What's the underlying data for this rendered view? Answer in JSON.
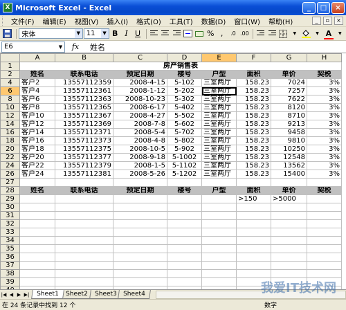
{
  "window": {
    "title": "Microsoft Excel - Excel",
    "app_icon": "excel-icon",
    "min": "_",
    "max": "□",
    "close": "×"
  },
  "menu": [
    "文件(F)",
    "编辑(E)",
    "视图(V)",
    "插入(I)",
    "格式(O)",
    "工具(T)",
    "数据(D)",
    "窗口(W)",
    "帮助(H)"
  ],
  "toolbar": {
    "font_name": "宋体",
    "font_size": "11",
    "bold": "B",
    "italic": "I",
    "underline": "U",
    "percent": "%",
    "comma": ","
  },
  "formula": {
    "cell_ref": "E6",
    "fx": "fx",
    "value": "姓名"
  },
  "columns": [
    "A",
    "B",
    "C",
    "D",
    "E",
    "F",
    "G",
    "H"
  ],
  "title_row": {
    "row": "1",
    "text": "房产销售表"
  },
  "header": [
    "姓名",
    "联系电话",
    "预定日期",
    "楼号",
    "户型",
    "面积",
    "单价",
    "契税"
  ],
  "header_rows": [
    "2",
    "28"
  ],
  "data_rows": [
    {
      "row": "4",
      "name": "客户2",
      "phone": "13557112359",
      "date": "2008-4-15",
      "bldg": "5-102",
      "type": "三室两厅",
      "area": "158.23",
      "price": "7024",
      "tax": "3%"
    },
    {
      "row": "6",
      "name": "客户4",
      "phone": "13557112361",
      "date": "2008-1-12",
      "bldg": "5-202",
      "type": "三室两厅",
      "area": "158.23",
      "price": "7257",
      "tax": "3%"
    },
    {
      "row": "8",
      "name": "客户6",
      "phone": "13557112363",
      "date": "2008-10-23",
      "bldg": "5-302",
      "type": "三室两厅",
      "area": "158.23",
      "price": "7622",
      "tax": "3%"
    },
    {
      "row": "10",
      "name": "客户8",
      "phone": "13557112365",
      "date": "2008-6-17",
      "bldg": "5-402",
      "type": "三室两厅",
      "area": "158.23",
      "price": "8120",
      "tax": "3%"
    },
    {
      "row": "12",
      "name": "客户10",
      "phone": "13557112367",
      "date": "2008-4-27",
      "bldg": "5-502",
      "type": "三室两厅",
      "area": "158.23",
      "price": "8710",
      "tax": "3%"
    },
    {
      "row": "14",
      "name": "客户12",
      "phone": "13557112369",
      "date": "2008-7-8",
      "bldg": "5-602",
      "type": "三室两厅",
      "area": "158.23",
      "price": "9213",
      "tax": "3%"
    },
    {
      "row": "16",
      "name": "客户14",
      "phone": "13557112371",
      "date": "2008-5-4",
      "bldg": "5-702",
      "type": "三室两厅",
      "area": "158.23",
      "price": "9458",
      "tax": "3%"
    },
    {
      "row": "18",
      "name": "客户16",
      "phone": "13557112373",
      "date": "2008-4-8",
      "bldg": "5-802",
      "type": "三室两厅",
      "area": "158.23",
      "price": "9810",
      "tax": "3%"
    },
    {
      "row": "20",
      "name": "客户18",
      "phone": "13557112375",
      "date": "2008-10-5",
      "bldg": "5-902",
      "type": "三室两厅",
      "area": "158.23",
      "price": "10250",
      "tax": "3%"
    },
    {
      "row": "22",
      "name": "客户20",
      "phone": "13557112377",
      "date": "2008-9-18",
      "bldg": "5-1002",
      "type": "三室两厅",
      "area": "158.23",
      "price": "12548",
      "tax": "3%"
    },
    {
      "row": "24",
      "name": "客户22",
      "phone": "13557112379",
      "date": "2008-1-5",
      "bldg": "5-1102",
      "type": "三室两厅",
      "area": "158.23",
      "price": "13562",
      "tax": "3%"
    },
    {
      "row": "26",
      "name": "客户24",
      "phone": "13557112381",
      "date": "2008-5-26",
      "bldg": "5-1202",
      "type": "三室两厅",
      "area": "158.23",
      "price": "15400",
      "tax": "3%"
    }
  ],
  "blank_row": "27",
  "criteria_row": {
    "row": "29",
    "area": ">150",
    "price": ">5000"
  },
  "empty_rows": [
    "30",
    "31",
    "32",
    "33",
    "34",
    "35",
    "36",
    "37",
    "38",
    "39",
    "40"
  ],
  "sheets": [
    "Sheet1",
    "Sheet2",
    "Sheet3",
    "Sheet4"
  ],
  "active_sheet": "Sheet1",
  "status": {
    "left": "在 24 条记录中找到 12 个",
    "mode": "数字"
  },
  "watermark": "我爱IT技术网"
}
